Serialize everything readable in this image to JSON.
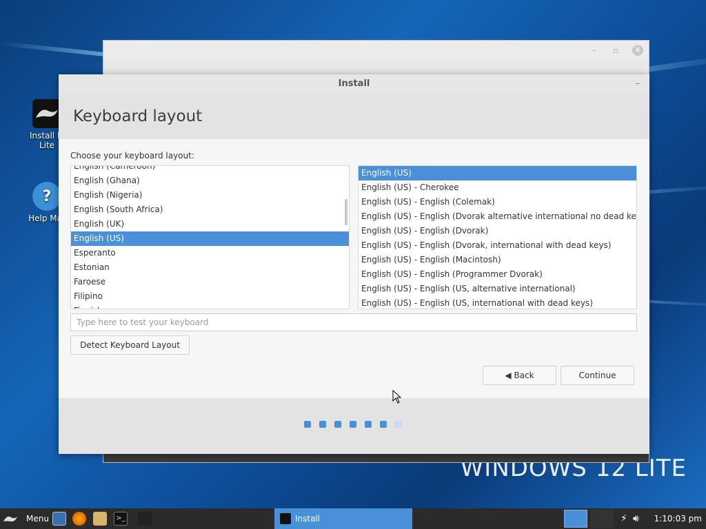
{
  "desktop": {
    "icons": [
      {
        "label": "Install Li\nLite",
        "icon": "installer-icon"
      },
      {
        "label": "Help Mar",
        "icon": "help-icon"
      }
    ],
    "watermark": "WINDOWS 12 LITE"
  },
  "window": {
    "title": "Install",
    "minimize": "–",
    "header": "Keyboard layout",
    "prompt": "Choose your keyboard layout:",
    "layouts": [
      {
        "label": "English (Cameroon)",
        "selected": false
      },
      {
        "label": "English (Ghana)",
        "selected": false
      },
      {
        "label": "English (Nigeria)",
        "selected": false
      },
      {
        "label": "English (South Africa)",
        "selected": false
      },
      {
        "label": "English (UK)",
        "selected": false
      },
      {
        "label": "English (US)",
        "selected": true
      },
      {
        "label": "Esperanto",
        "selected": false
      },
      {
        "label": "Estonian",
        "selected": false
      },
      {
        "label": "Faroese",
        "selected": false
      },
      {
        "label": "Filipino",
        "selected": false
      },
      {
        "label": "Finnish",
        "selected": false
      }
    ],
    "variants": [
      {
        "label": "English (US)",
        "selected": true
      },
      {
        "label": "English (US) - Cherokee",
        "selected": false
      },
      {
        "label": "English (US) - English (Colemak)",
        "selected": false
      },
      {
        "label": "English (US) - English (Dvorak alternative international no dead keys)",
        "selected": false
      },
      {
        "label": "English (US) - English (Dvorak)",
        "selected": false
      },
      {
        "label": "English (US) - English (Dvorak, international with dead keys)",
        "selected": false
      },
      {
        "label": "English (US) - English (Macintosh)",
        "selected": false
      },
      {
        "label": "English (US) - English (Programmer Dvorak)",
        "selected": false
      },
      {
        "label": "English (US) - English (US, alternative international)",
        "selected": false
      },
      {
        "label": "English (US) - English (US, international with dead keys)",
        "selected": false
      }
    ],
    "test_placeholder": "Type here to test your keyboard",
    "detect_label": "Detect Keyboard Layout",
    "back_label": "Back",
    "continue_label": "Continue",
    "progress": {
      "current_step": 6,
      "total_steps": 7
    }
  },
  "taskbar": {
    "menu_label": "Menu",
    "task_label": "Install",
    "clock": "1:10:03 pm"
  },
  "colors": {
    "accent": "#4a90d9",
    "taskbar": "#2b2b2b"
  }
}
